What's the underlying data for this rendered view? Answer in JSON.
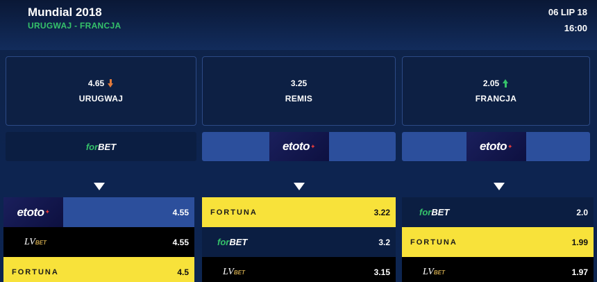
{
  "header": {
    "title": "Mundial 2018",
    "teams": "URUGWAJ - FRANCJA",
    "date": "06 LIP 18",
    "time": "16:00"
  },
  "odds": [
    {
      "value": "4.65",
      "label": "URUGWAJ",
      "trend": "down"
    },
    {
      "value": "3.25",
      "label": "REMIS",
      "trend": "none"
    },
    {
      "value": "2.05",
      "label": "FRANCJA",
      "trend": "up"
    }
  ],
  "best_bookmakers": [
    {
      "name": "forBET",
      "icon": "forbet-logo"
    },
    {
      "name": "etoto",
      "icon": "etoto-logo"
    },
    {
      "name": "etoto",
      "icon": "etoto-logo"
    }
  ],
  "logos": {
    "forbet_for": "for",
    "forbet_bet": "BET",
    "etoto": "etoto",
    "etoto_star": "✦",
    "fortuna": "FORTUNA",
    "lvbet_lv": "LV",
    "lvbet_bet": "BET"
  },
  "lists": [
    {
      "rows": [
        {
          "bookmaker": "etoto",
          "value": "4.55"
        },
        {
          "bookmaker": "lvbet",
          "value": "4.55"
        },
        {
          "bookmaker": "fortuna",
          "value": "4.5"
        }
      ]
    },
    {
      "rows": [
        {
          "bookmaker": "fortuna",
          "value": "3.22"
        },
        {
          "bookmaker": "forbet",
          "value": "3.2"
        },
        {
          "bookmaker": "lvbet",
          "value": "3.15"
        }
      ]
    },
    {
      "rows": [
        {
          "bookmaker": "forbet",
          "value": "2.0"
        },
        {
          "bookmaker": "fortuna",
          "value": "1.99"
        },
        {
          "bookmaker": "lvbet",
          "value": "1.97"
        }
      ]
    }
  ],
  "colors": {
    "accent_green": "#35c26a",
    "trend_down": "#e07a3c",
    "etoto_blue": "#2c4f9c",
    "fortuna_yellow": "#f8e23a",
    "forbet_navy": "#0b1e42"
  }
}
